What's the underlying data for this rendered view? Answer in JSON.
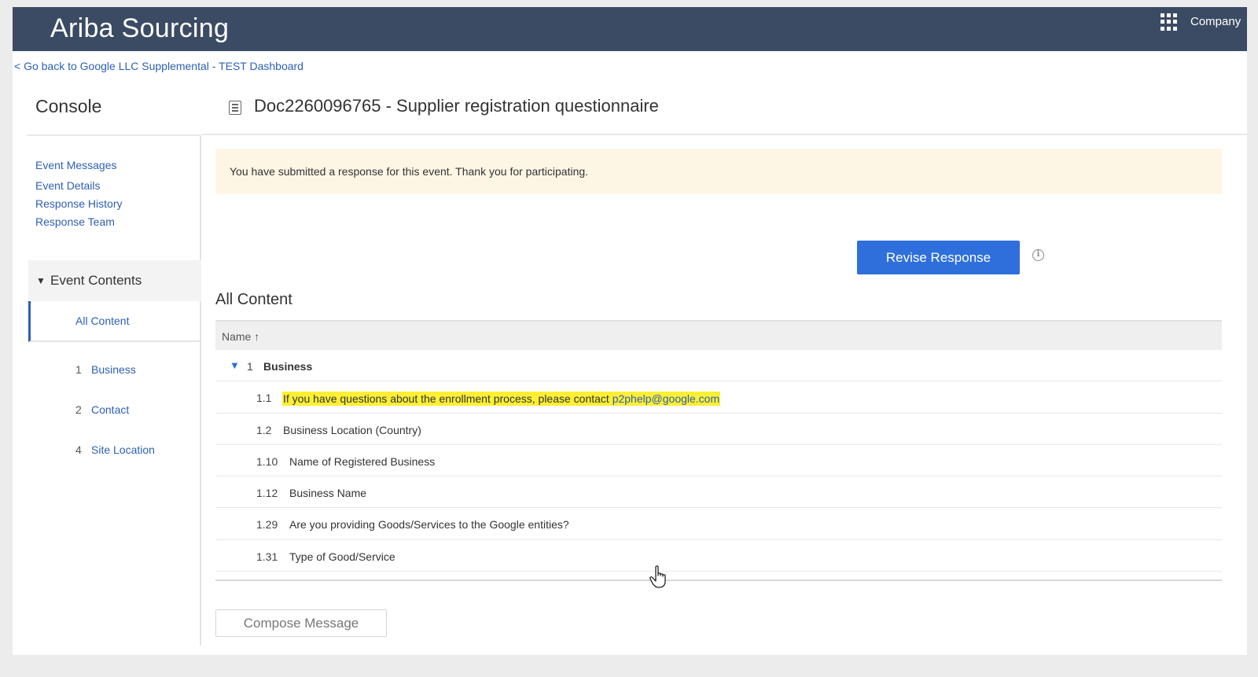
{
  "header": {
    "app_title": "Ariba Sourcing",
    "apps_icon": "grid-icon",
    "company_label": "Company"
  },
  "breadcrumb": {
    "back_link": "< Go back to Google LLC Supplemental - TEST Dashboard"
  },
  "sidebar": {
    "title": "Console",
    "links": [
      "Event Messages",
      "Event Details",
      "Response History",
      "Response Team"
    ],
    "event_contents_label": "Event Contents",
    "all_content_label": "All Content",
    "tree": [
      {
        "num": "1",
        "label": "Business"
      },
      {
        "num": "2",
        "label": "Contact"
      },
      {
        "num": "4",
        "label": "Site Location"
      }
    ]
  },
  "main": {
    "doc_icon": "document-icon",
    "doc_title": "Doc2260096765 - Supplier registration questionnaire",
    "notice": "You have submitted a response for this event.  Thank you for participating.",
    "revise_button": "Revise Response",
    "info_icon": "info-icon",
    "section_title": "All Content",
    "table": {
      "column_header": "Name ↑",
      "group": {
        "num": "1",
        "label": "Business"
      },
      "highlight_row": {
        "num": "1.1",
        "text": "If you have questions about the enrollment process, please contact ",
        "email": "p2phelp@google.com"
      },
      "rows": [
        {
          "num": "1.2",
          "label": "Business Location (Country)"
        },
        {
          "num": "1.10",
          "label": "Name of Registered Business"
        },
        {
          "num": "1.12",
          "label": "Business Name"
        },
        {
          "num": "1.29",
          "label": "Are you providing Goods/Services to the Google entities?"
        },
        {
          "num": "1.31",
          "label": "Type of Good/Service"
        }
      ]
    },
    "compose_button": "Compose Message"
  },
  "colors": {
    "header_bg": "#3c4b64",
    "link": "#2d5fb3",
    "primary_button": "#2e6fdb",
    "notice_bg": "#fdf6e4",
    "highlight": "#fcef35"
  }
}
